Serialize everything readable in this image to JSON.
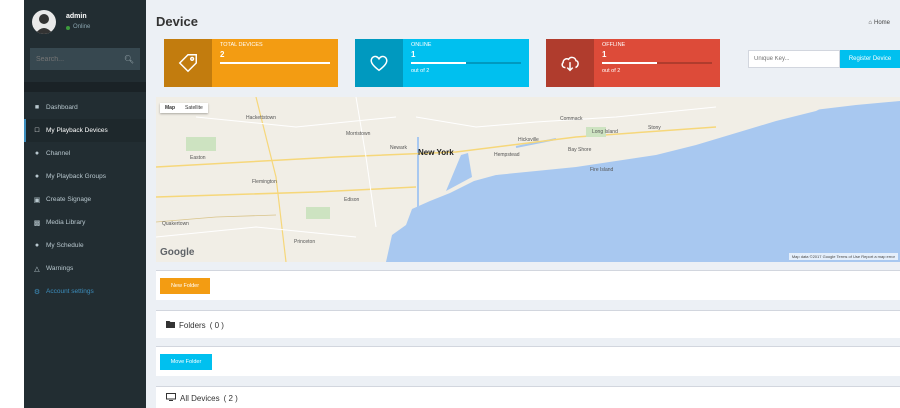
{
  "user": {
    "name": "admin",
    "status": "Online"
  },
  "sidebar": {
    "search_placeholder": "Search...",
    "items": [
      {
        "label": "Dashboard",
        "icon": "dashboard-icon"
      },
      {
        "label": "My Playback Devices",
        "icon": "monitor-icon"
      },
      {
        "label": "Channel",
        "icon": "users-icon"
      },
      {
        "label": "My Playback Groups",
        "icon": "users-icon"
      },
      {
        "label": "Create Signage",
        "icon": "calendar-icon"
      },
      {
        "label": "Media Library",
        "icon": "image-icon"
      },
      {
        "label": "My Schedule",
        "icon": "users-icon"
      },
      {
        "label": "Warnings",
        "icon": "bell-icon"
      },
      {
        "label": "Account settings",
        "icon": "gears-icon"
      }
    ]
  },
  "page": {
    "title": "Device",
    "breadcrumb_home": "Home"
  },
  "stats": {
    "total": {
      "label": "TOTAL DEVICES",
      "value": "2",
      "progress": 1.0,
      "color": "#f39c12"
    },
    "online": {
      "label": "ONLINE",
      "value": "1",
      "desc": "out of 2",
      "progress": 0.5,
      "color": "#00c0ef"
    },
    "offline": {
      "label": "OFFLINE",
      "value": "1",
      "desc": "out of 2",
      "progress": 0.5,
      "color": "#dd4b39"
    }
  },
  "register": {
    "placeholder": "Unique Key...",
    "button_label": "Register Device"
  },
  "map": {
    "tab_map": "Map",
    "tab_satellite": "Satellite",
    "city": "New York",
    "labels": [
      "Hackettstown",
      "Morristown",
      "Newark",
      "Hempstead",
      "Hicksville",
      "Commack",
      "Long Island",
      "Bay Shore",
      "Fire Island",
      "Edison",
      "Easton",
      "Flemington",
      "Quakertown",
      "Princeton",
      "Stony"
    ],
    "attribution": "Map data ©2017 Google   Terms of Use   Report a map error",
    "logo": "Google"
  },
  "actions": {
    "new_folder": "New Folder",
    "move_folder": "Move Folder"
  },
  "folders": {
    "label": "Folders",
    "count": "( 0 )"
  },
  "devices": {
    "label": "All Devices",
    "count": "( 2 )"
  },
  "colors": {
    "sidebar_bg": "#222d32",
    "content_bg": "#ecf0f5",
    "accent": "#3c8dbc",
    "warning_btn": "#f39c12",
    "info_btn": "#00c0ef"
  }
}
